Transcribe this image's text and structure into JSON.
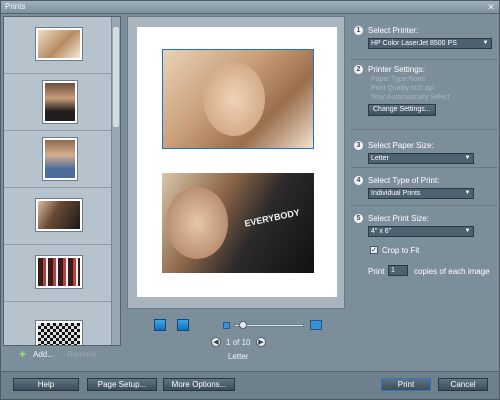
{
  "window": {
    "title": "Prints",
    "close_glyph": "✕"
  },
  "thumbnails": {
    "items": [
      {
        "name": "thumb-1",
        "color": "#d9b89a"
      },
      {
        "name": "thumb-2",
        "color": "#6b4f3c"
      },
      {
        "name": "thumb-3",
        "color": "#8f6a4e"
      },
      {
        "name": "thumb-4",
        "color": "#2d2826"
      },
      {
        "name": "thumb-5",
        "color": "#5a2a2a"
      },
      {
        "name": "thumb-6",
        "color": "#c7c7c7"
      }
    ],
    "add_label": "Add...",
    "remove_label": "Remove"
  },
  "preview": {
    "page_indicator": "1 of 10",
    "paper_label": "Letter",
    "zoom_level_fraction": 0.15
  },
  "settings": {
    "sections": [
      {
        "num": "1",
        "label": "Select Printer:",
        "value": "HP Color LaserJet 8500 PS"
      },
      {
        "num": "2",
        "label": "Printer Settings:",
        "lines": [
          "Paper Type:None",
          "Print Quality:600 dpi",
          "Tray:Automatically Select"
        ],
        "button": "Change Settings..."
      },
      {
        "num": "3",
        "label": "Select Paper Size:",
        "value": "Letter"
      },
      {
        "num": "4",
        "label": "Select Type of Print:",
        "value": "Individual Prints"
      },
      {
        "num": "5",
        "label": "Select Print Size:",
        "value": "4\" x 6\"",
        "checkbox_label": "Crop to Fit",
        "checkbox_checked": true,
        "print_word": "Print",
        "copies": "1",
        "copies_suffix": "copies of each image"
      }
    ]
  },
  "bottom": {
    "help": "Help",
    "page_setup": "Page Setup...",
    "more_options": "More Options...",
    "print": "Print",
    "cancel": "Cancel"
  }
}
